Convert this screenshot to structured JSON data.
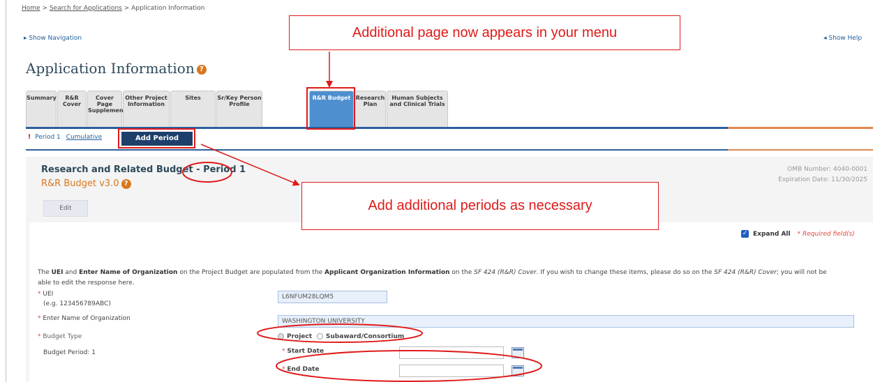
{
  "breadcrumb": {
    "home": "Home",
    "sep1": " > ",
    "search": "Search for Applications",
    "sep2": " > ",
    "current": "Application Information"
  },
  "nav": {
    "show_navigation": "▸ Show Navigation",
    "show_help": "◂ Show Help"
  },
  "page_title": "Application Information",
  "tabs": [
    {
      "label": "Summary",
      "active": false
    },
    {
      "label": "R&R Cover",
      "active": false
    },
    {
      "label": "Cover Page Supplement",
      "active": false
    },
    {
      "label": "Other Project Information",
      "active": false
    },
    {
      "label": "Sites",
      "active": false
    },
    {
      "label": "Sr/Key Person Profile",
      "active": false
    },
    {
      "label": "R&R Budget",
      "active": true
    },
    {
      "label": "Research Plan",
      "active": false
    },
    {
      "label": "Human Subjects and Clinical Trials",
      "active": false
    }
  ],
  "periods": {
    "period1": "Period 1",
    "cumulative": "Cumulative",
    "add_period": "Add Period",
    "warning_mark": "!"
  },
  "form": {
    "title": "Research and Related Budget - Period 1",
    "subtitle": "R&R Budget v3.0",
    "omb_number": "OMB Number: 4040-0001",
    "expiration": "Expiration Date: 11/30/2025",
    "edit_label": "Edit",
    "expand_all": "Expand All",
    "required_note": "* Required field(s)",
    "intro": {
      "p1": "The ",
      "b1": "UEI",
      "p2": " and ",
      "b2": "Enter Name of Organization",
      "p3": " on the Project Budget are populated from the ",
      "b3": "Applicant Organization Information",
      "p4": " on the ",
      "i1": "SF 424 (R&R) Cover",
      "p5": ". If you wish to change these items, please do so on the ",
      "i2": "SF 424 (R&R) Cover",
      "p6": "; you will not be able to edit the response here."
    },
    "uei_label": "UEI",
    "uei_example": "(e.g. 123456789ABC)",
    "uei_value": "L6NFUM28LQM5",
    "org_label": "Enter Name of Organization",
    "org_value": "WASHINGTON UNIVERSITY",
    "budget_type_label": "Budget Type",
    "budget_type_project": "Project",
    "budget_type_subaward": "Subaward/Consortium",
    "budget_period_label": "Budget Period: 1",
    "start_date_label": "Start Date",
    "end_date_label": "End Date",
    "required_star": "*"
  },
  "callouts": {
    "menu_note": "Additional page now appears in your menu",
    "periods_note": "Add additional periods as necessary"
  },
  "colors": {
    "annotation_red": "#e01a1a",
    "tab_active": "#4e8fcf",
    "nav_blue": "#2b5f9e",
    "accent_orange": "#e08850",
    "button_navy": "#1e3f6b"
  }
}
